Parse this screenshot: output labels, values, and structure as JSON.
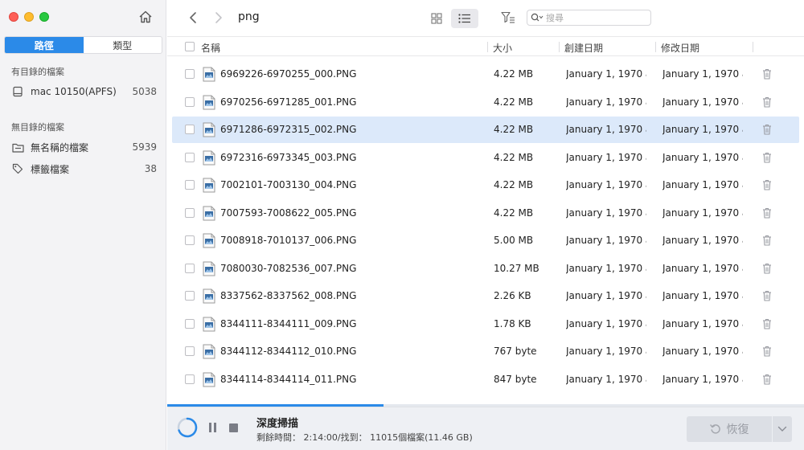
{
  "sidebar": {
    "tabs": [
      {
        "label": "路徑",
        "active": true
      },
      {
        "label": "類型",
        "active": false
      }
    ],
    "sections": [
      {
        "heading": "有目錄的檔案",
        "items": [
          {
            "label": "mac 10150(APFS)",
            "count": "5038",
            "icon": "drive-icon"
          }
        ]
      },
      {
        "heading": "無目錄的檔案",
        "items": [
          {
            "label": "無名稱的檔案",
            "count": "5939",
            "icon": "folder-icon"
          },
          {
            "label": "標籤檔案",
            "count": "38",
            "icon": "tag-icon"
          }
        ]
      }
    ]
  },
  "toolbar": {
    "folder_title": "png",
    "search_placeholder": "搜尋"
  },
  "table": {
    "columns": {
      "name": "名稱",
      "size": "大小",
      "created": "創建日期",
      "modified": "修改日期"
    },
    "rows": [
      {
        "name": "6969226-6970255_000.PNG",
        "size": "4.22 MB",
        "created": "January 1, 1970 a...",
        "modified": "January 1, 1970 a...",
        "selected": false
      },
      {
        "name": "6970256-6971285_001.PNG",
        "size": "4.22 MB",
        "created": "January 1, 1970 a...",
        "modified": "January 1, 1970 a...",
        "selected": false
      },
      {
        "name": "6971286-6972315_002.PNG",
        "size": "4.22 MB",
        "created": "January 1, 1970 a...",
        "modified": "January 1, 1970 a...",
        "selected": true
      },
      {
        "name": "6972316-6973345_003.PNG",
        "size": "4.22 MB",
        "created": "January 1, 1970 a...",
        "modified": "January 1, 1970 a...",
        "selected": false
      },
      {
        "name": "7002101-7003130_004.PNG",
        "size": "4.22 MB",
        "created": "January 1, 1970 a...",
        "modified": "January 1, 1970 a...",
        "selected": false
      },
      {
        "name": "7007593-7008622_005.PNG",
        "size": "4.22 MB",
        "created": "January 1, 1970 a...",
        "modified": "January 1, 1970 a...",
        "selected": false
      },
      {
        "name": "7008918-7010137_006.PNG",
        "size": "5.00 MB",
        "created": "January 1, 1970 a...",
        "modified": "January 1, 1970 a...",
        "selected": false
      },
      {
        "name": "7080030-7082536_007.PNG",
        "size": "10.27 MB",
        "created": "January 1, 1970 a...",
        "modified": "January 1, 1970 a...",
        "selected": false
      },
      {
        "name": "8337562-8337562_008.PNG",
        "size": "2.26 KB",
        "created": "January 1, 1970 a...",
        "modified": "January 1, 1970 a...",
        "selected": false
      },
      {
        "name": "8344111-8344111_009.PNG",
        "size": "1.78 KB",
        "created": "January 1, 1970 a...",
        "modified": "January 1, 1970 a...",
        "selected": false
      },
      {
        "name": "8344112-8344112_010.PNG",
        "size": "767 byte",
        "created": "January 1, 1970 a...",
        "modified": "January 1, 1970 a...",
        "selected": false
      },
      {
        "name": "8344114-8344114_011.PNG",
        "size": "847 byte",
        "created": "January 1, 1970 a...",
        "modified": "January 1, 1970 a...",
        "selected": false
      }
    ]
  },
  "scan": {
    "title": "深度掃描",
    "status": "剩餘時間： 2:14:00/找到： 11015個檔案(11.46 GB)",
    "progress": 0.34
  },
  "recover": {
    "label": "恢復",
    "enabled": false
  },
  "colors": {
    "accent": "#2b8ae8",
    "selected_row": "#dce9fa"
  }
}
